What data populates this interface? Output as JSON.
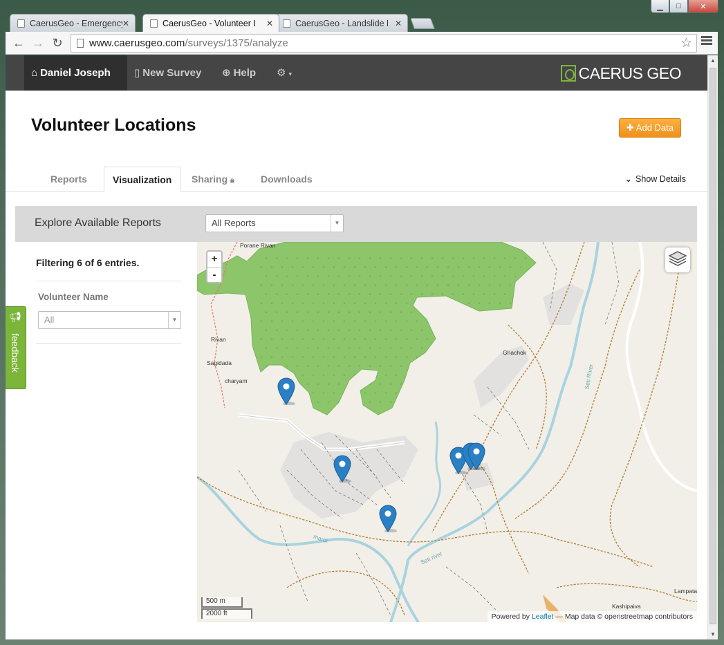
{
  "browser": {
    "tabs": [
      {
        "title": "CaerusGeo - Emergency S",
        "active": false
      },
      {
        "title": "CaerusGeo - Volunteer Lo",
        "active": true
      },
      {
        "title": "CaerusGeo - Landslide Ha",
        "active": false
      }
    ],
    "url_host": "www.caerusgeo.com",
    "url_path": "/surveys/1375/analyze"
  },
  "navbar": {
    "user": "Daniel Joseph",
    "new_survey": "New Survey",
    "help": "Help",
    "logo_text_left": "C",
    "logo_text_right": "AERUS GEO"
  },
  "page": {
    "title": "Volunteer Locations",
    "add_data": "Add Data"
  },
  "tabs": {
    "reports": "Reports",
    "visualization": "Visualization",
    "sharing": "Sharing",
    "downloads": "Downloads",
    "show_details": "Show Details"
  },
  "explore": {
    "label": "Explore Available Reports",
    "select_value": "All Reports"
  },
  "sidebar": {
    "filter_text": "Filtering 6 of 6 entries.",
    "volunteer_label": "Volunteer Name",
    "volunteer_value": "All"
  },
  "map": {
    "zoom_in": "+",
    "zoom_out": "-",
    "scale_metric": "500 m",
    "scale_imperial": "2000 ft",
    "attribution_prefix": "Powered by",
    "attribution_link": "Leaflet",
    "attribution_suffix": "— Map data © openstreetmap contributors",
    "labels": [
      "Porane Rivan",
      "Rivan",
      "Sagidada",
      "charyam",
      "Ghachok",
      "Seti River",
      "mardi",
      "Seti river",
      "Kashipaiva",
      "Lampata"
    ]
  },
  "feedback": {
    "label": "feedback"
  },
  "colors": {
    "accent_orange": "#f0901c",
    "brand_green": "#7bb63a",
    "marker_blue": "#2a7fc5",
    "navbar": "#454545"
  }
}
